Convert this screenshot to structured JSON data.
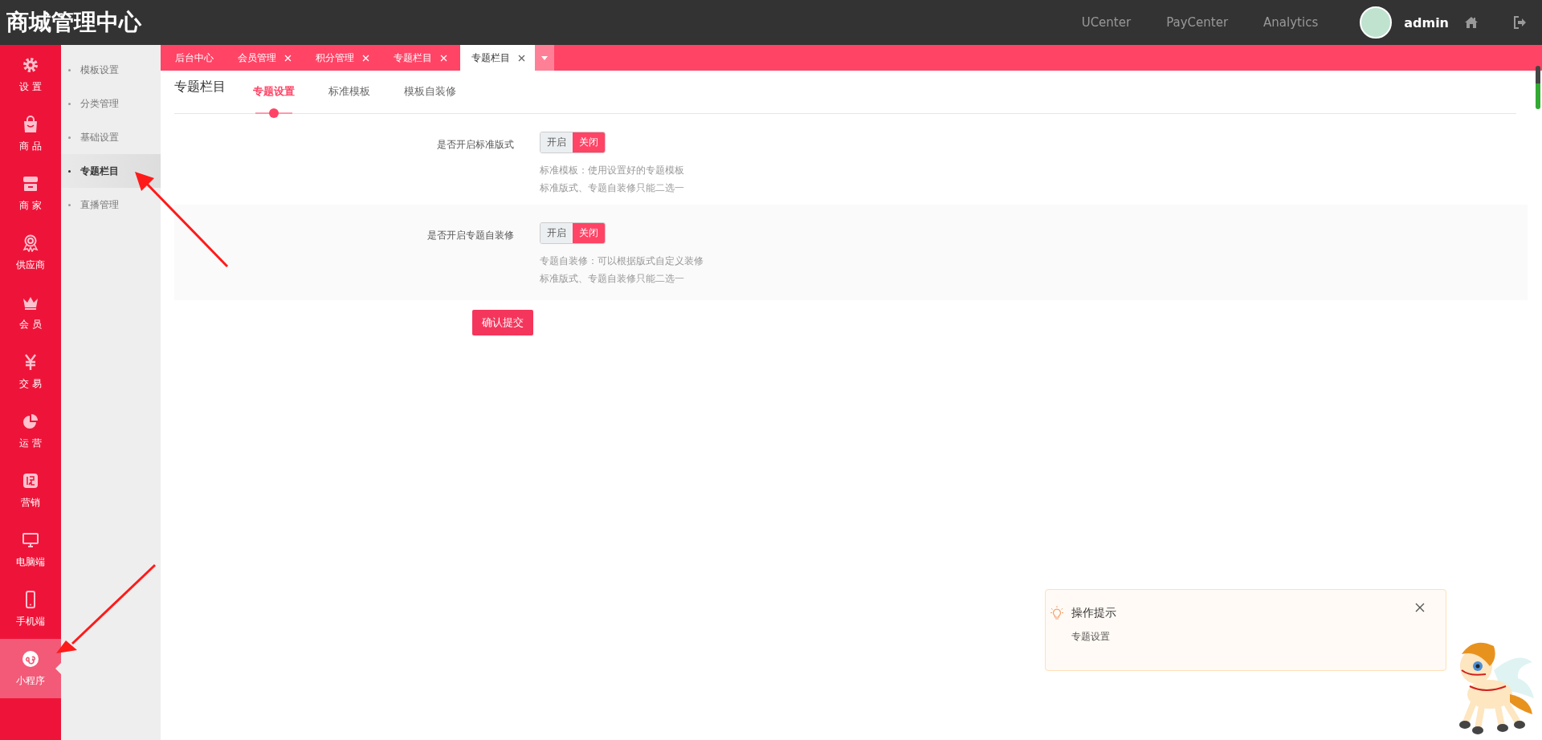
{
  "header": {
    "title": "商城管理中心",
    "links": [
      "UCenter",
      "PayCenter",
      "Analytics"
    ],
    "user": "admin"
  },
  "rail": [
    {
      "label": "设 置",
      "selected": false
    },
    {
      "label": "商 品",
      "selected": false
    },
    {
      "label": "商 家",
      "selected": false
    },
    {
      "label": "供应商",
      "selected": false
    },
    {
      "label": "会 员",
      "selected": false
    },
    {
      "label": "交 易",
      "selected": false
    },
    {
      "label": "运 营",
      "selected": false
    },
    {
      "label": "营销",
      "selected": false
    },
    {
      "label": "电脑端",
      "selected": false
    },
    {
      "label": "手机端",
      "selected": false
    },
    {
      "label": "小程序",
      "selected": true
    }
  ],
  "subnav": [
    {
      "label": "模板设置",
      "selected": false
    },
    {
      "label": "分类管理",
      "selected": false
    },
    {
      "label": "基础设置",
      "selected": false
    },
    {
      "label": "专题栏目",
      "selected": true
    },
    {
      "label": "直播管理",
      "selected": false
    }
  ],
  "tabs": [
    {
      "label": "后台中心",
      "closable": false,
      "selected": false
    },
    {
      "label": "会员管理",
      "closable": true,
      "selected": false
    },
    {
      "label": "积分管理",
      "closable": true,
      "selected": false
    },
    {
      "label": "专题栏目",
      "closable": true,
      "selected": false
    },
    {
      "label": "专题栏目",
      "closable": true,
      "selected": true
    }
  ],
  "page": {
    "title": "专题栏目",
    "subtabs": [
      {
        "label": "专题设置",
        "selected": true
      },
      {
        "label": "标准模板",
        "selected": false
      },
      {
        "label": "模板自装修",
        "selected": false
      }
    ]
  },
  "form": {
    "rows": [
      {
        "label": "是否开启标准版式",
        "options": [
          {
            "label": "开启",
            "selected": false
          },
          {
            "label": "关闭",
            "selected": true
          }
        ],
        "hints": [
          "标准模板：使用设置好的专题模板",
          "标准版式、专题自装修只能二选一"
        ]
      },
      {
        "label": "是否开启专题自装修",
        "options": [
          {
            "label": "开启",
            "selected": false
          },
          {
            "label": "关闭",
            "selected": true
          }
        ],
        "hints": [
          "专题自装修：可以根据版式自定义装修",
          "标准版式、专题自装修只能二选一"
        ]
      }
    ],
    "submit": "确认提交"
  },
  "tip": {
    "title": "操作提示",
    "text": "专题设置"
  }
}
